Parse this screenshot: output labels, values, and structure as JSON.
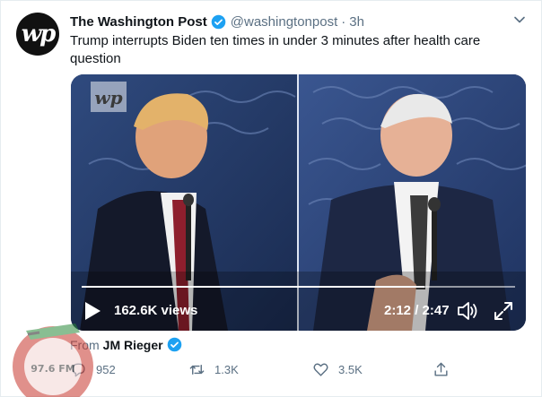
{
  "tweet": {
    "author_name": "The Washington Post",
    "author_handle": "@washingtonpost",
    "separator": "·",
    "time": "3h",
    "avatar_text": "wp",
    "text": "Trump interrupts Biden ten times in under 3 minutes after health care question"
  },
  "video": {
    "views": "162.6K views",
    "duration": "2:12 / 2:47",
    "progress": 0.79,
    "overlay_logo": "wp"
  },
  "attribution": {
    "prefix": "From",
    "source_name": "JM Rieger"
  },
  "actions": {
    "reply_count": "952",
    "retweet_count": "1.3K",
    "like_count": "3.5K"
  },
  "watermark": {
    "label": "97.6 FM"
  },
  "colors": {
    "verified": "#1da1f2",
    "muted": "#5b7083",
    "text": "#0f1419",
    "video_backdrop": "#1c2a4a"
  },
  "icons": {
    "verified": "verified-badge-icon",
    "chevron": "chevron-down-icon",
    "play": "play-icon",
    "volume": "volume-icon",
    "fullscreen": "fullscreen-icon",
    "reply": "reply-icon",
    "retweet": "retweet-icon",
    "like": "heart-icon",
    "share": "share-icon"
  }
}
